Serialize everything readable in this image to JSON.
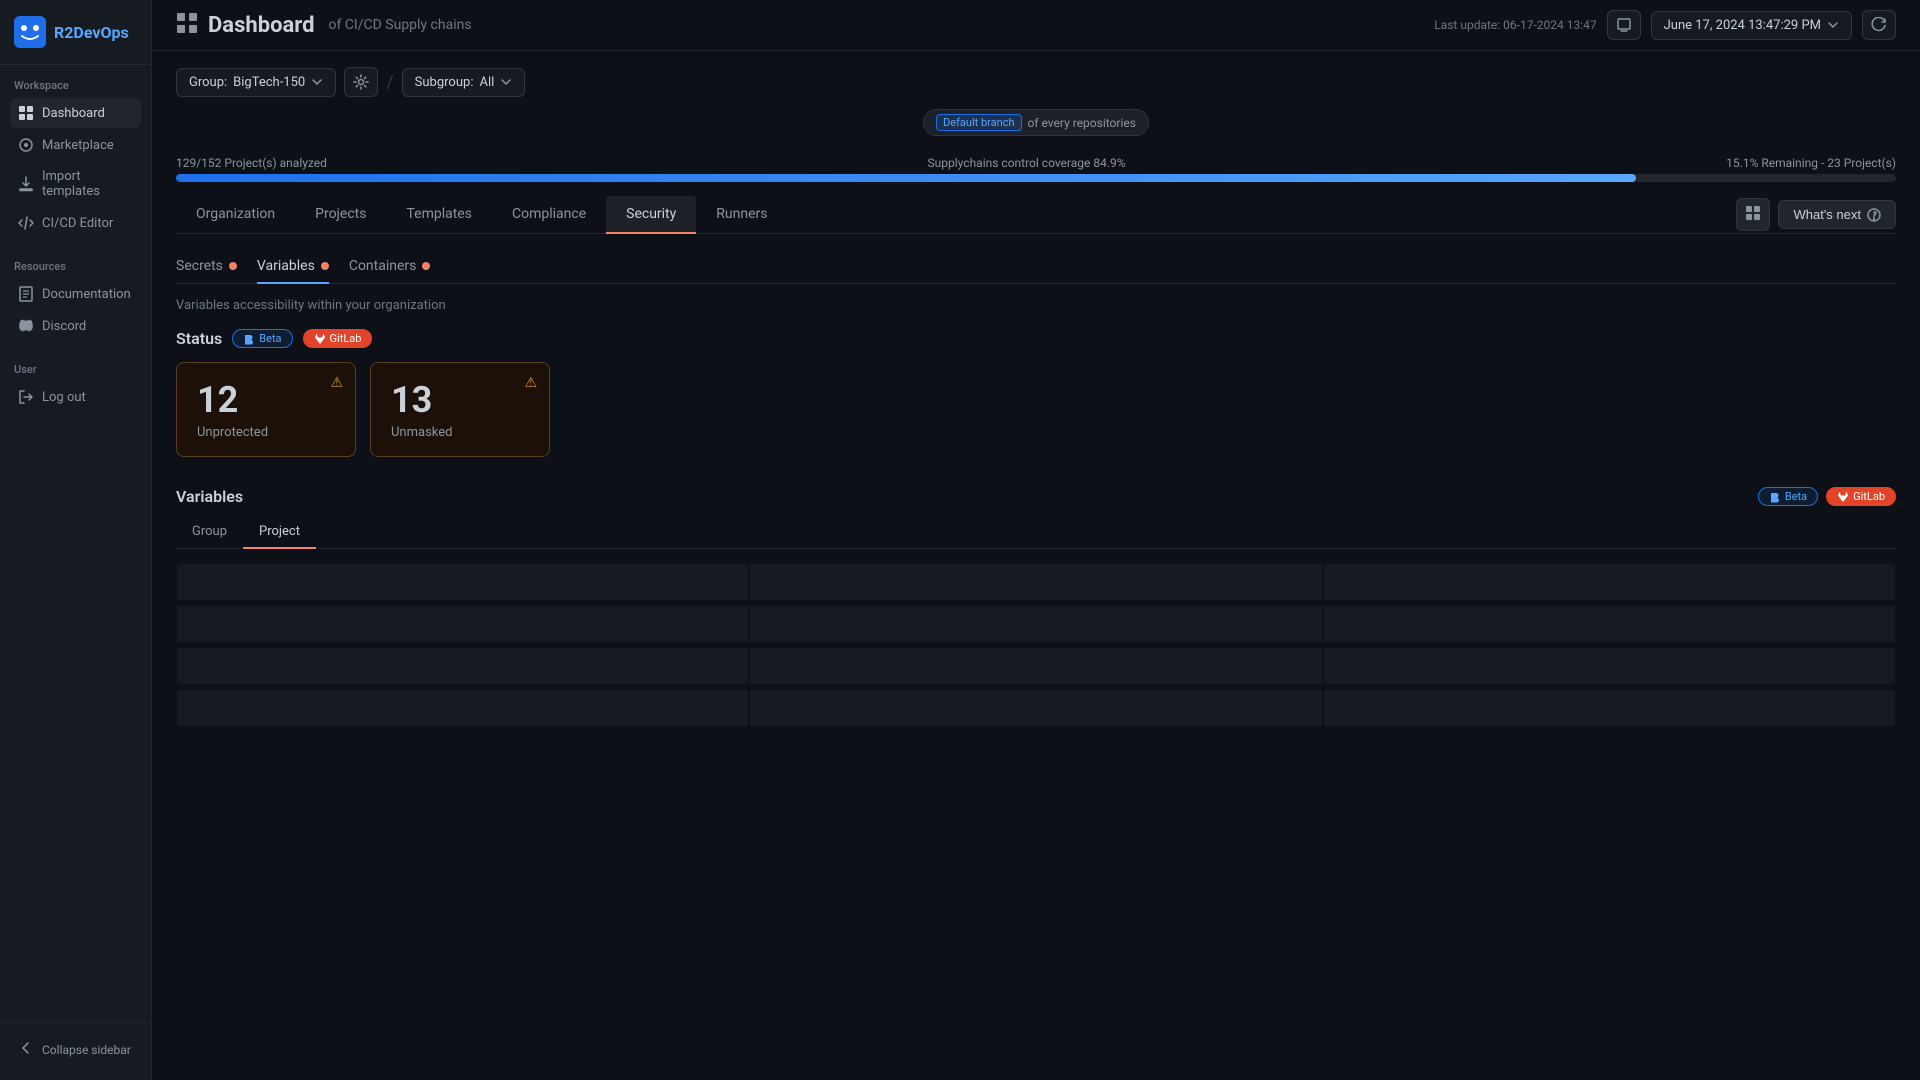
{
  "app": {
    "name": "R2DevOps",
    "logo_text": "R2DevOps"
  },
  "sidebar": {
    "workspace_label": "Workspace",
    "resources_label": "Resources",
    "user_label": "User",
    "items": {
      "dashboard": "Dashboard",
      "marketplace": "Marketplace",
      "import_templates": "Import templates",
      "cicd_editor": "CI/CD Editor",
      "documentation": "Documentation",
      "discord": "Discord",
      "logout": "Log out"
    },
    "collapse_label": "Collapse sidebar"
  },
  "topbar": {
    "title": "Dashboard",
    "subtitle": "of CI/CD Supply chains",
    "last_update_label": "Last update: 06-17-2024 13:47",
    "date": "June 17, 2024 13:47:29 PM"
  },
  "branch_banner": {
    "badge": "Default branch",
    "text": "of every repositories"
  },
  "progress": {
    "left_label": "129/152 Project(s) analyzed",
    "center_label": "Supplychains control coverage 84.9%",
    "right_label": "15.1% Remaining - 23 Project(s)",
    "fill_percent": 84.9
  },
  "tabs": {
    "items": [
      "Organization",
      "Projects",
      "Templates",
      "Compliance",
      "Security",
      "Runners"
    ],
    "active": "Security",
    "whats_next": "What's next"
  },
  "security": {
    "sub_tabs": [
      "Secrets",
      "Variables",
      "Containers"
    ],
    "active_sub_tab": "Variables",
    "description": "Variables accessibility within your organization",
    "status_section_title": "Status",
    "badge_beta": "Beta",
    "badge_gitlab": "GitLab",
    "cards": [
      {
        "number": "12",
        "label": "Unprotected"
      },
      {
        "number": "13",
        "label": "Unmasked"
      }
    ],
    "variables_section_title": "Variables",
    "var_badge_beta": "Beta",
    "var_badge_gitlab": "GitLab",
    "var_tabs": [
      "Group",
      "Project"
    ],
    "active_var_tab": "Project"
  }
}
